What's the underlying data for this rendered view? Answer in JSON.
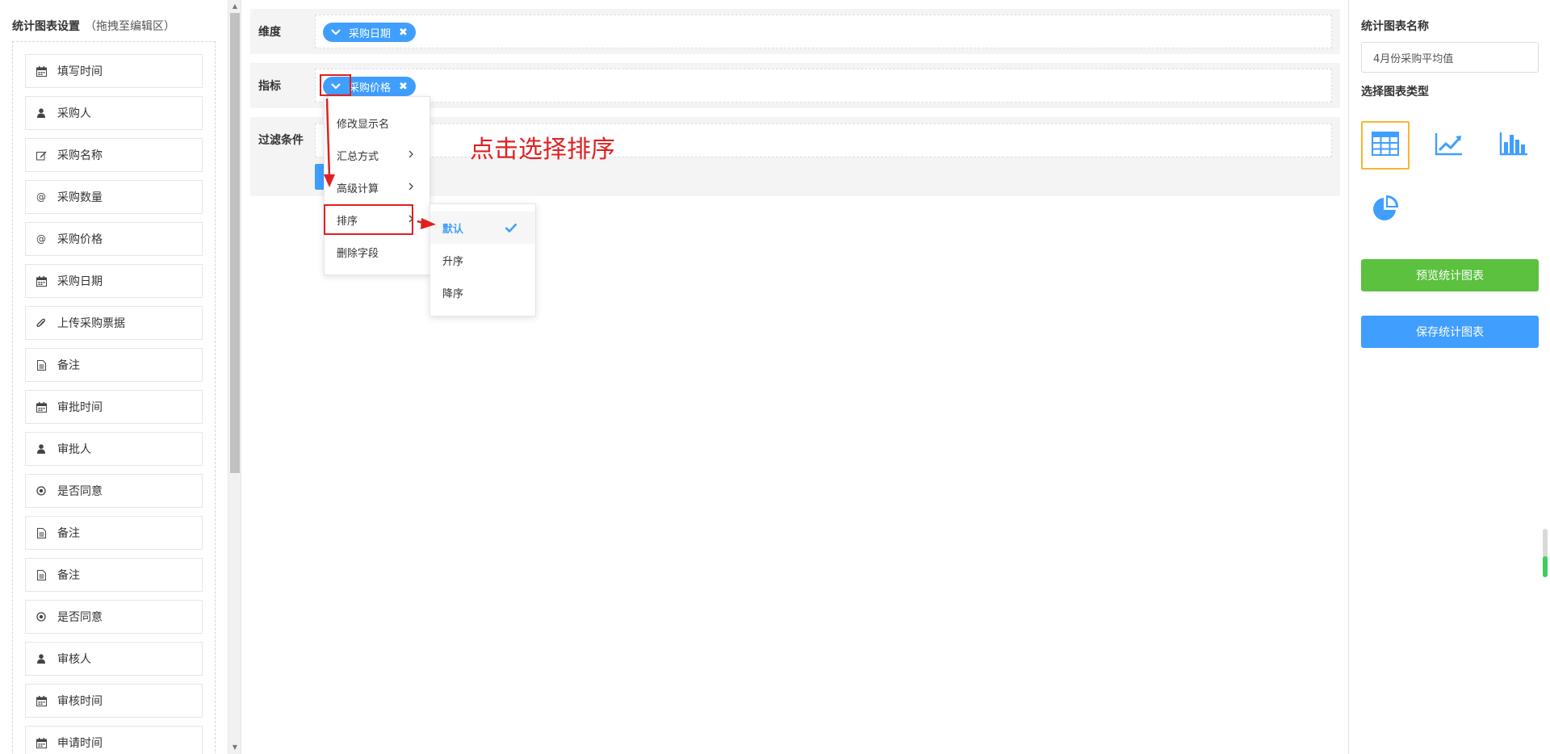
{
  "left": {
    "title": "统计图表设置",
    "hint": "（拖拽至编辑区）",
    "fields": [
      {
        "label": "填写时间",
        "icon": "calendar-icon"
      },
      {
        "label": "采购人",
        "icon": "user-icon"
      },
      {
        "label": "采购名称",
        "icon": "edit-icon"
      },
      {
        "label": "采购数量",
        "icon": "at-icon"
      },
      {
        "label": "采购价格",
        "icon": "at-icon"
      },
      {
        "label": "采购日期",
        "icon": "calendar-icon"
      },
      {
        "label": "上传采购票据",
        "icon": "paperclip-icon"
      },
      {
        "label": "备注",
        "icon": "document-icon"
      },
      {
        "label": "审批时间",
        "icon": "calendar-icon"
      },
      {
        "label": "审批人",
        "icon": "user-icon"
      },
      {
        "label": "是否同意",
        "icon": "radio-icon"
      },
      {
        "label": "备注",
        "icon": "document-icon"
      },
      {
        "label": "备注",
        "icon": "document-icon"
      },
      {
        "label": "是否同意",
        "icon": "radio-icon"
      },
      {
        "label": "审核人",
        "icon": "user-icon"
      },
      {
        "label": "审核时间",
        "icon": "calendar-icon"
      },
      {
        "label": "申请时间",
        "icon": "calendar-icon"
      }
    ]
  },
  "main": {
    "dimension_label": "维度",
    "dimension_tag": "采购日期",
    "metric_label": "指标",
    "metric_tag": "采购价格",
    "filter_label": "过滤条件",
    "context_menu": [
      "修改显示名",
      "汇总方式",
      "高级计算",
      "排序",
      "删除字段"
    ],
    "sort_submenu": [
      "默认",
      "升序",
      "降序"
    ],
    "annotation": "点击选择排序"
  },
  "right": {
    "name_label": "统计图表名称",
    "name_value": "4月份采购平均值",
    "type_label": "选择图表类型",
    "chart_types": [
      "table-icon",
      "line-chart-icon",
      "bar-chart-icon",
      "pie-chart-icon"
    ],
    "preview_button": "预览统计图表",
    "save_button": "保存统计图表"
  },
  "colors": {
    "accent": "#409eff",
    "green": "#5bc13f",
    "annotation": "#e02020",
    "selected_border": "#f5b731"
  }
}
